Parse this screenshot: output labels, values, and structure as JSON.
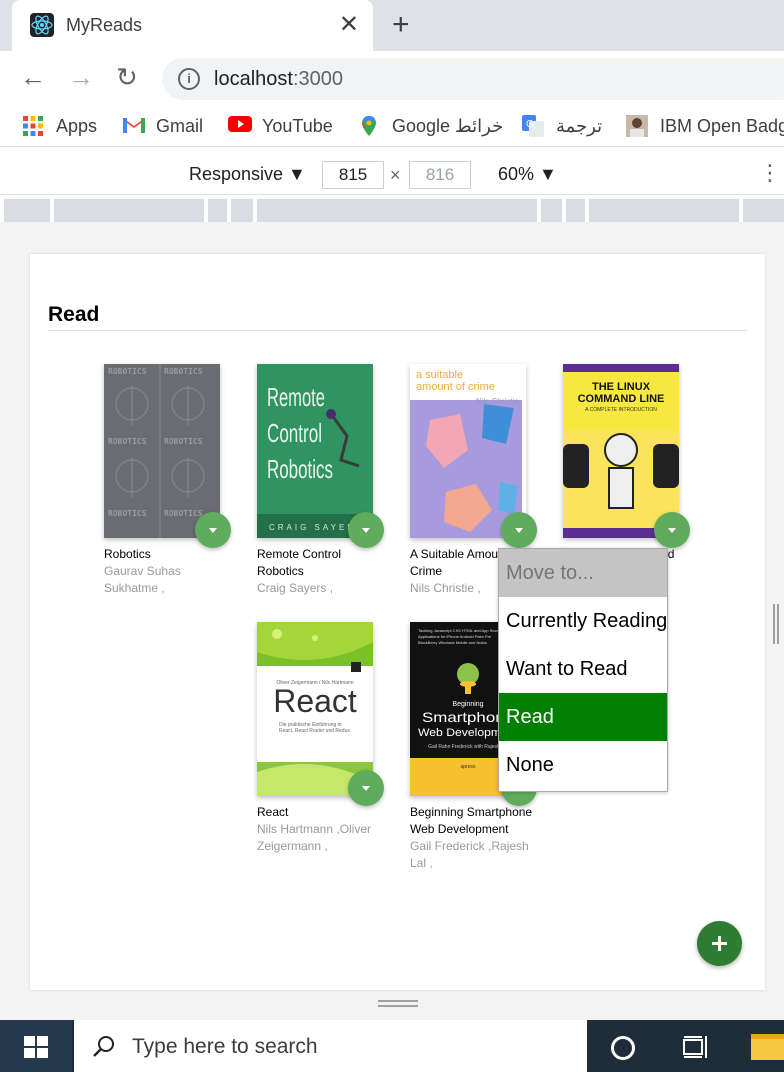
{
  "browser": {
    "tab_title": "MyReads",
    "tab_close": "✕",
    "new_tab": "+",
    "url_host": "localhost",
    "url_port": ":3000",
    "nav": {
      "back": "←",
      "forward": "→",
      "reload": "↻"
    }
  },
  "bookmarks": [
    {
      "label": "Apps",
      "icon": "apps-grid-icon"
    },
    {
      "label": "Gmail",
      "icon": "gmail-icon"
    },
    {
      "label": "YouTube",
      "icon": "youtube-icon"
    },
    {
      "label": "Google خرائط",
      "icon": "google-maps-icon"
    },
    {
      "label": "ترجمة",
      "icon": "google-translate-icon"
    },
    {
      "label": "IBM Open Badg",
      "icon": "ibm-badge-icon"
    }
  ],
  "devtools": {
    "mode": "Responsive ▼",
    "width": "815",
    "times": "×",
    "height": "816",
    "zoom": "60% ▼",
    "more": "⋮"
  },
  "shelf": {
    "title": "Read"
  },
  "books": [
    {
      "title": "Robotics",
      "authors": "Gaurav Suhas Sukhatme ,",
      "cover_text": "ROBOTICS"
    },
    {
      "title": "Remote Control Robotics",
      "authors": "Craig Sayers ,",
      "cover_text": "Remote Control Robotics",
      "cover_sub": "CRAIG SAYERS"
    },
    {
      "title": "A Suitable Amount of Crime",
      "authors": "Nils Christie ,",
      "cover_text": "a suitable amount of crime",
      "cover_sub": "Nils Christie"
    },
    {
      "title": "The Linux Command Line",
      "authors": "",
      "cover_text": "THE LINUX COMMAND LINE",
      "cover_sub": "A COMPLETE INTRODUCTION"
    },
    {
      "title": "React",
      "authors": "Nils Hartmann ,Oliver Zeigermann ,",
      "cover_text": "React"
    },
    {
      "title": "Beginning Smartphone Web Development",
      "authors": "Gail Frederick ,Rajesh Lal ,",
      "cover_text": "Beginning Smartphone Web Development"
    }
  ],
  "menu": {
    "items": [
      {
        "label": "Move to...",
        "state": "disabled"
      },
      {
        "label": "Currently Reading",
        "state": "normal"
      },
      {
        "label": "Want to Read",
        "state": "normal"
      },
      {
        "label": "Read",
        "state": "selected"
      },
      {
        "label": "None",
        "state": "normal"
      }
    ]
  },
  "taskbar": {
    "search_placeholder": "Type here to search"
  },
  "colors": {
    "changer": "#60ac5d",
    "selected": "#008000",
    "add": "#2e7d32"
  }
}
